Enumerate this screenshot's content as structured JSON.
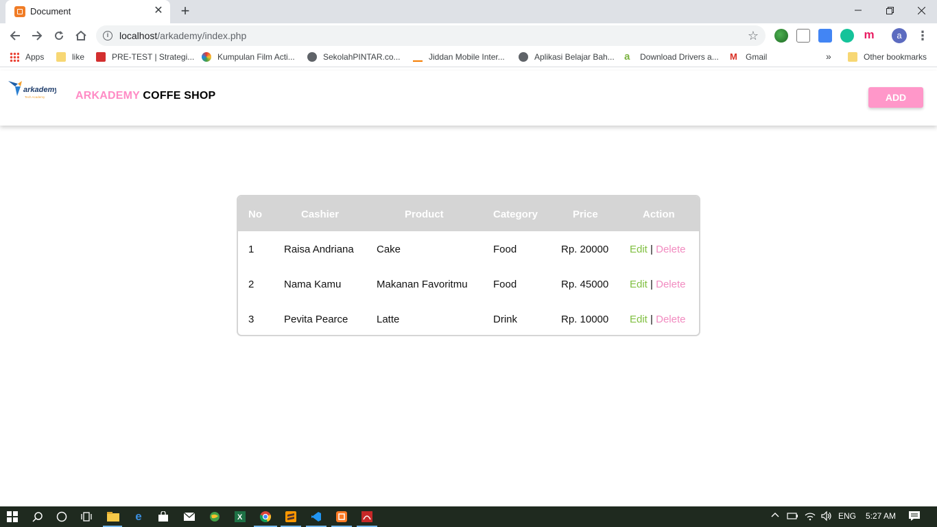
{
  "browser": {
    "tab_title": "Document",
    "url_host": "localhost",
    "url_path": "/arkademy/index.php",
    "profile_initial": "a"
  },
  "bookmarks": [
    {
      "label": "Apps"
    },
    {
      "label": "like"
    },
    {
      "label": "PRE-TEST | Strategi..."
    },
    {
      "label": "Kumpulan Film Acti..."
    },
    {
      "label": "SekolahPINTAR.co..."
    },
    {
      "label": "Jiddan Mobile Inter..."
    },
    {
      "label": "Aplikasi Belajar Bah..."
    },
    {
      "label": "Download Drivers a..."
    },
    {
      "label": "Gmail"
    }
  ],
  "bookmarks_overflow": "»",
  "other_bookmarks": "Other bookmarks",
  "header": {
    "logo_text": "arkademy",
    "logo_subtext": "Tech Academy",
    "brand_part1": "ARKADEMY",
    "brand_part2": "COFFE SHOP",
    "add_label": "ADD"
  },
  "table": {
    "columns": [
      "No",
      "Cashier",
      "Product",
      "Category",
      "Price",
      "Action"
    ],
    "rows": [
      {
        "no": "1",
        "cashier": "Raisa Andriana",
        "product": "Cake",
        "category": "Food",
        "price": "Rp. 20000"
      },
      {
        "no": "2",
        "cashier": "Nama Kamu",
        "product": "Makanan Favoritmu",
        "category": "Food",
        "price": "Rp. 45000"
      },
      {
        "no": "3",
        "cashier": "Pevita Pearce",
        "product": "Latte",
        "category": "Drink",
        "price": "Rp. 10000"
      }
    ],
    "edit_label": "Edit",
    "separator": "|",
    "delete_label": "Delete"
  },
  "taskbar": {
    "language": "ENG",
    "time": "5:27 AM"
  },
  "colors": {
    "brand_pink": "#ff8bc5",
    "button_pink": "#ff97c9",
    "edit_green": "#7fbf3f",
    "delete_pink": "#f28bc0",
    "table_header": "#d5d5d5"
  }
}
